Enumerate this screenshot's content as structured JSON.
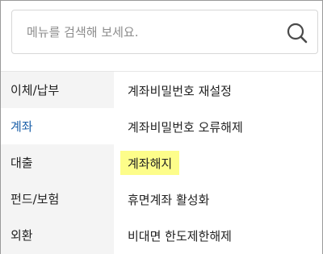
{
  "search": {
    "placeholder": "메뉴를 검색해 보세요.",
    "icon": "search-icon"
  },
  "sidebar": {
    "items": [
      {
        "label": "이체/납부",
        "active": false
      },
      {
        "label": "계좌",
        "active": true
      },
      {
        "label": "대출",
        "active": false
      },
      {
        "label": "펀드/보험",
        "active": false
      },
      {
        "label": "외환",
        "active": false
      }
    ]
  },
  "menu": {
    "items": [
      {
        "label": "계좌비밀번호 재설정",
        "highlighted": false
      },
      {
        "label": "계좌비밀번호 오류해제",
        "highlighted": false
      },
      {
        "label": "계좌해지",
        "highlighted": true
      },
      {
        "label": "휴면계좌 활성화",
        "highlighted": false
      },
      {
        "label": "비대면 한도제한해제",
        "highlighted": false
      }
    ]
  },
  "colors": {
    "active_sidebar_text": "#1a5fa8",
    "highlight": "#fdfd8a",
    "sidebar_bg": "#f4f4f4"
  }
}
